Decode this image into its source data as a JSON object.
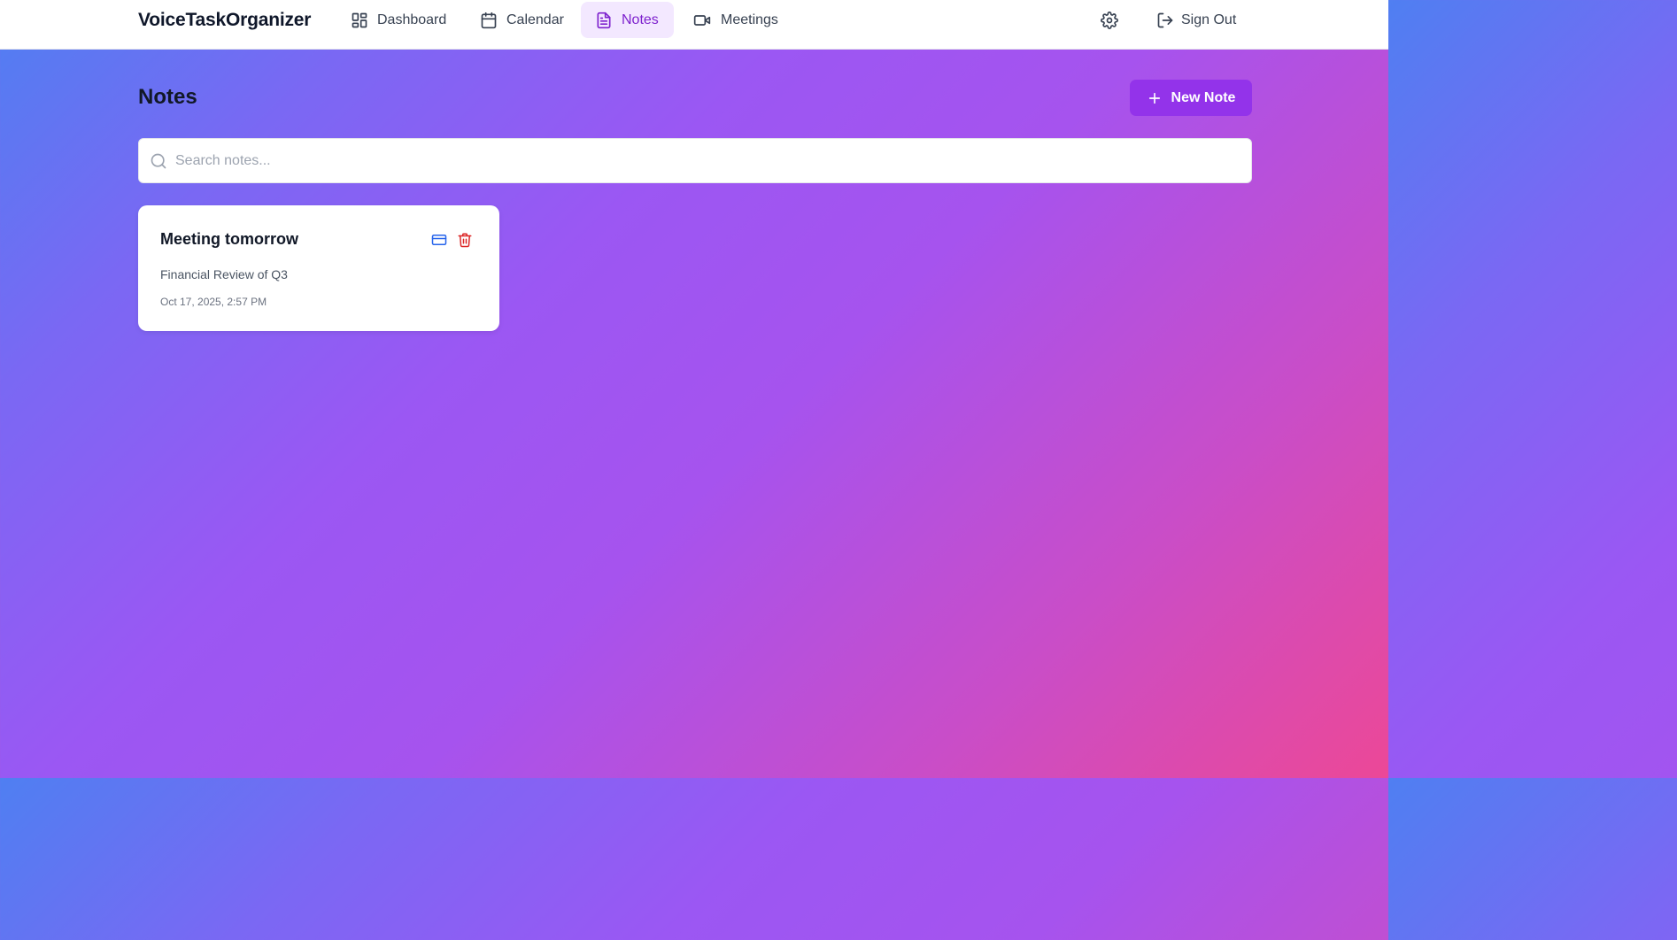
{
  "app": {
    "brand": "VoiceTaskOrganizer"
  },
  "nav": {
    "items": [
      {
        "label": "Dashboard",
        "icon": "dashboard-grid-icon"
      },
      {
        "label": "Calendar",
        "icon": "calendar-icon"
      },
      {
        "label": "Notes",
        "icon": "document-icon",
        "active": true
      },
      {
        "label": "Meetings",
        "icon": "video-camera-icon"
      }
    ],
    "settings_icon": "gear-icon",
    "signout": {
      "label": "Sign Out",
      "icon": "logout-icon"
    }
  },
  "page": {
    "title": "Notes",
    "new_note_label": "New Note",
    "new_note_icon": "plus-icon"
  },
  "search": {
    "placeholder": "Search notes...",
    "value": "",
    "icon": "search-icon"
  },
  "notes": [
    {
      "title": "Meeting tomorrow",
      "body": "Financial Review of Q3",
      "date": "Oct 17, 2025, 2:57 PM",
      "actions": [
        "edit-icon",
        "trash-icon"
      ]
    }
  ],
  "colors": {
    "accent": "#9333ea",
    "active_nav_bg": "#f3e8ff",
    "active_nav_text": "#7e22ce",
    "edit_icon": "#2563eb",
    "delete_icon": "#dc2626",
    "gradient_start": "#4f7ff2",
    "gradient_mid": "#a653ee",
    "gradient_end": "#ec4897"
  }
}
